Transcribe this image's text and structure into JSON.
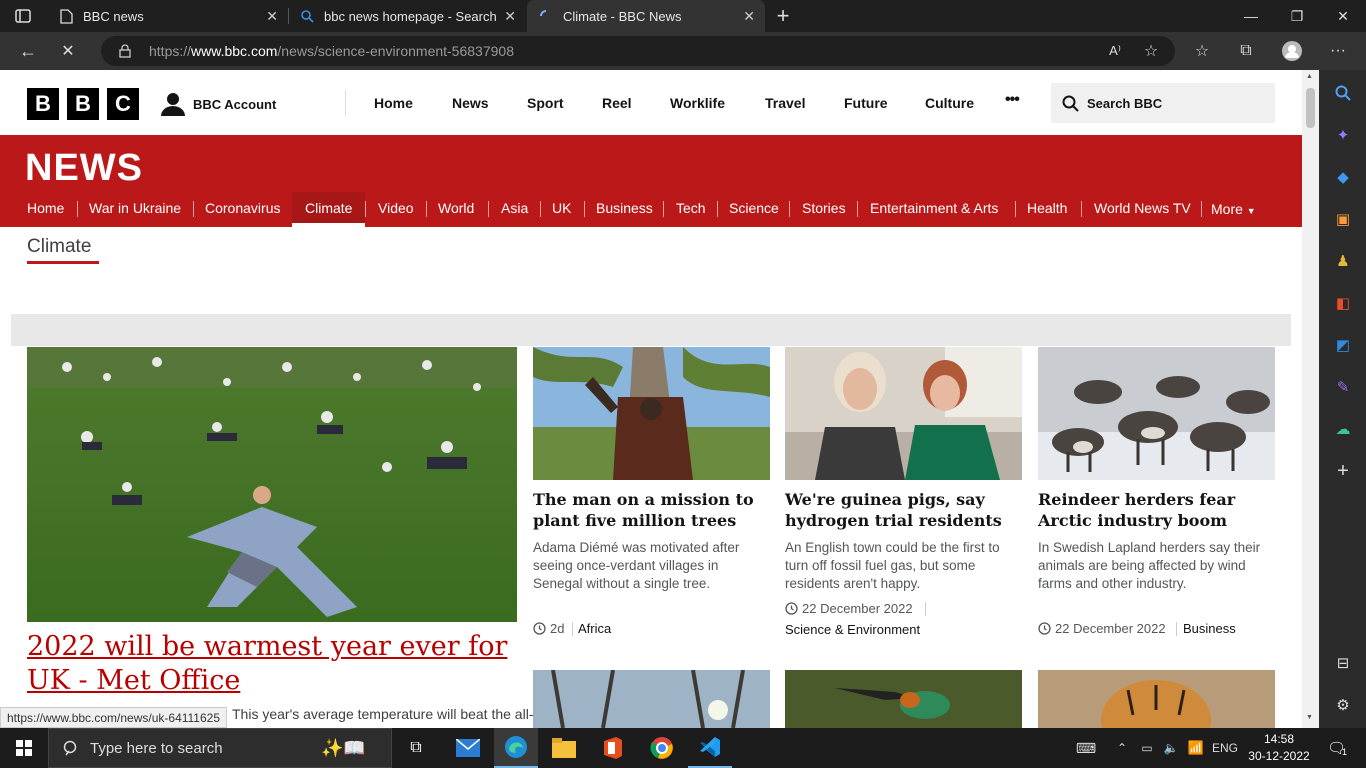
{
  "browser": {
    "tabs": [
      {
        "title": "BBC news"
      },
      {
        "title": "bbc news homepage - Search"
      },
      {
        "title": "Climate - BBC News"
      }
    ],
    "url_prefix": "https://",
    "url_domain": "www.bbc.com",
    "url_path": "/news/science-environment-56837908",
    "status_url": "https://www.bbc.com/news/uk-64111625"
  },
  "bbc": {
    "logo_letters": [
      "B",
      "B",
      "C"
    ],
    "account_label": "BBC Account",
    "top_nav": [
      "Home",
      "News",
      "Sport",
      "Reel",
      "Worklife",
      "Travel",
      "Future",
      "Culture"
    ],
    "more_dots": "•••",
    "search_label": "Search BBC"
  },
  "news": {
    "logo": "NEWS",
    "nav": [
      "Home",
      "War in Ukraine",
      "Coronavirus",
      "Climate",
      "Video",
      "World",
      "Asia",
      "UK",
      "Business",
      "Tech",
      "Science",
      "Stories",
      "Entertainment & Arts",
      "Health",
      "World News TV"
    ],
    "more_label": "More",
    "active_nav": "Climate",
    "section_title": "Climate"
  },
  "lead": {
    "headline": "2022 will be warmest year ever for UK - Met Office",
    "summary": "This year's average temperature will beat the all-"
  },
  "cards": [
    {
      "title": "The man on a mission to plant five million trees",
      "summary": "Adama Diémé was motivated after seeing once-verdant villages in Senegal without a single tree.",
      "time": "2d",
      "tag": "Africa"
    },
    {
      "title": "We're guinea pigs, say hydrogen trial residents",
      "summary": "An English town could be the first to turn off fossil fuel gas, but some residents aren't happy.",
      "time": "22 December 2022",
      "tag": "Science & Environment"
    },
    {
      "title": "Reindeer herders fear Arctic industry boom",
      "summary": "In Swedish Lapland herders say their animals are being affected by wind farms and other industry.",
      "time": "22 December 2022",
      "tag": "Business"
    }
  ],
  "taskbar": {
    "search_placeholder": "Type here to search",
    "lang": "ENG",
    "time": "14:58",
    "date": "30-12-2022",
    "notif_count": "1"
  },
  "colors": {
    "bbc_red": "#bb1919",
    "link_red": "#b80000"
  }
}
